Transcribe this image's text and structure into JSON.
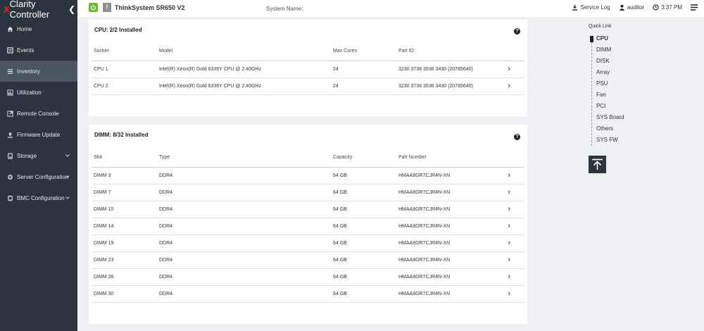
{
  "brand": {
    "x": "X",
    "rest": "Clarity Controller"
  },
  "sidebar": {
    "items": [
      {
        "label": "Home",
        "icon": "home-icon"
      },
      {
        "label": "Events",
        "icon": "events-icon"
      },
      {
        "label": "Inventory",
        "icon": "list-icon",
        "active": true
      },
      {
        "label": "Utilization",
        "icon": "chart-icon"
      },
      {
        "label": "Remote Console",
        "icon": "console-icon"
      },
      {
        "label": "Firmware Update",
        "icon": "upload-icon"
      },
      {
        "label": "Storage",
        "icon": "storage-icon",
        "expand": true
      },
      {
        "label": "Server Configuration",
        "icon": "gear-icon",
        "expand": true
      },
      {
        "label": "BMC Configuration",
        "icon": "chip-icon",
        "expand": true
      }
    ]
  },
  "header": {
    "model": "ThinkSystem  SR650 V2",
    "system_name_label": "System Name:",
    "warn": "!",
    "service_log": "Service Log",
    "user": "auditor",
    "time": "3:37 PM"
  },
  "cpu": {
    "title": "CPU:  2/2 Installed",
    "columns": [
      "Socket",
      "Model",
      "Max Cores",
      "Part ID"
    ],
    "rows": [
      [
        "CPU 1",
        "Intel(R) Xeon(R) Gold 6336Y CPU @ 2.40GHz",
        "24",
        "3230 3738 3536 3430 (20785640)"
      ],
      [
        "CPU 2",
        "Intel(R) Xeon(R) Gold 6336Y CPU @ 2.40GHz",
        "24",
        "3230 3738 3536 3430 (20785640)"
      ]
    ]
  },
  "dimm": {
    "title": "DIMM:  8/32 Installed",
    "columns": [
      "Slot",
      "Type",
      "Capacity",
      "Part Number"
    ],
    "rows": [
      [
        "DIMM 3",
        "DDR4",
        "64 GB",
        "HMAA8GR7CJR4N-XN"
      ],
      [
        "DIMM 7",
        "DDR4",
        "64 GB",
        "HMAA8GR7CJR4N-XN"
      ],
      [
        "DIMM 10",
        "DDR4",
        "64 GB",
        "HMAA8GR7CJR4N-XN"
      ],
      [
        "DIMM 14",
        "DDR4",
        "64 GB",
        "HMAA8GR7CJR4N-XN"
      ],
      [
        "DIMM 19",
        "DDR4",
        "64 GB",
        "HMAA8GR7CJR4N-XN"
      ],
      [
        "DIMM 23",
        "DDR4",
        "64 GB",
        "HMAA8GR7CJR4N-XN"
      ],
      [
        "DIMM 26",
        "DDR4",
        "64 GB",
        "HMAA8GR7CJR4N-XN"
      ],
      [
        "DIMM 30",
        "DDR4",
        "64 GB",
        "HMAA8GR7CJR4N-XN"
      ]
    ]
  },
  "help": "?",
  "row_arrow": "›",
  "quick_link": {
    "title": "Quick Link",
    "items": [
      "CPU",
      "DIMM",
      "DISK",
      "Array",
      "PSU",
      "Fan",
      "PCI",
      "SYS Board",
      "Others",
      "SYS FW"
    ]
  },
  "colors": {
    "sidebar": "#2c3440",
    "active": "#4a5563",
    "power": "#6fb83d",
    "brand_x": "#e2231a"
  }
}
